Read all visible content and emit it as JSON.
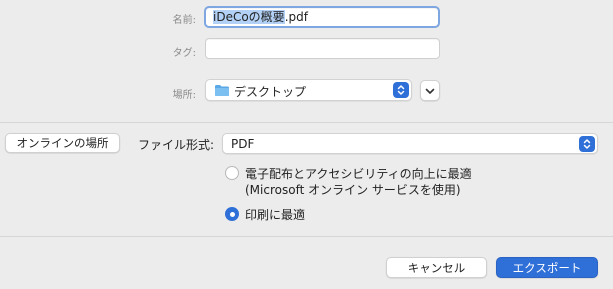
{
  "form": {
    "name_label": "名前:",
    "name_value_selected": "iDeCoの概要",
    "name_value_rest": ".pdf",
    "tags_label": "タグ:",
    "tags_value": "",
    "location_label": "場所:",
    "location_value": "デスクトップ",
    "location_icon": "folder-icon"
  },
  "options": {
    "online_button": "オンラインの場所",
    "format_label": "ファイル形式:",
    "format_value": "PDF",
    "radio_accessibility_line1": "電子配布とアクセシビリティの向上に最適",
    "radio_accessibility_line2": "(Microsoft オンライン サービスを使用)",
    "radio_accessibility_selected": false,
    "radio_print": "印刷に最適",
    "radio_print_selected": true
  },
  "footer": {
    "cancel_button": "キャンセル",
    "export_button": "エクスポート"
  },
  "colors": {
    "accent": "#2f6fd8",
    "selection": "#b3d1f6",
    "focus_ring": "#7ea6e0",
    "background": "#ececec"
  }
}
